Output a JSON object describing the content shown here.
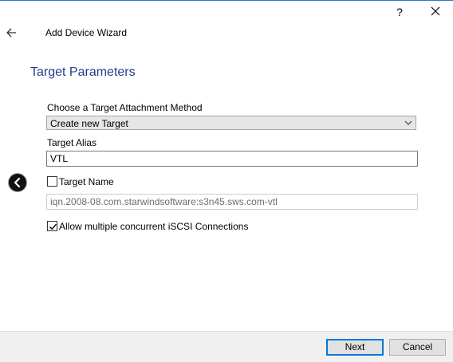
{
  "window": {
    "help_label": "?",
    "close_icon": "close-icon",
    "accent_color": "#2b78c5"
  },
  "header": {
    "back_icon": "back-arrow-icon",
    "title": "Add Device Wizard"
  },
  "section": {
    "title": "Target Parameters"
  },
  "form": {
    "attachment_label": "Choose a Target Attachment Method",
    "attachment_value": "Create new Target",
    "alias_label": "Target Alias",
    "alias_value": "VTL",
    "target_name_label": "Target Name",
    "target_name_checked": false,
    "target_name_value": "iqn.2008-08.com.starwindsoftware:s3n45.sws.com-vtl",
    "multi_conn_label": "Allow multiple concurrent iSCSI Connections",
    "multi_conn_checked": true
  },
  "side_nav": {
    "icon": "chevron-left-icon"
  },
  "footer": {
    "next_label": "Next",
    "cancel_label": "Cancel"
  }
}
